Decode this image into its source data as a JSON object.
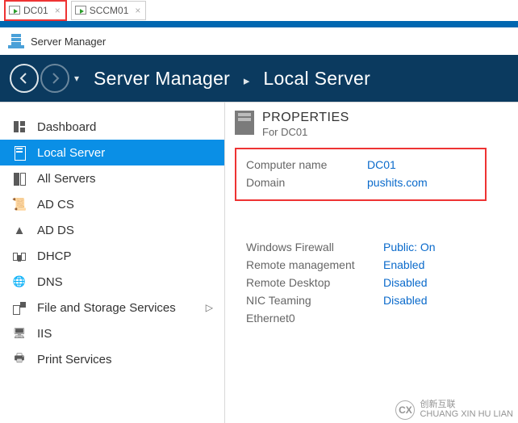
{
  "vm_tabs": [
    {
      "label": "DC01",
      "active": true
    },
    {
      "label": "SCCM01",
      "active": false
    }
  ],
  "window_title": "Server Manager",
  "breadcrumb": {
    "root": "Server Manager",
    "page": "Local Server",
    "sep": "▸"
  },
  "sidebar": {
    "items": [
      {
        "label": "Dashboard"
      },
      {
        "label": "Local Server"
      },
      {
        "label": "All Servers"
      },
      {
        "label": "AD CS"
      },
      {
        "label": "AD DS"
      },
      {
        "label": "DHCP"
      },
      {
        "label": "DNS"
      },
      {
        "label": "File and Storage Services"
      },
      {
        "label": "IIS"
      },
      {
        "label": "Print Services"
      }
    ]
  },
  "properties": {
    "heading": "PROPERTIES",
    "for_prefix": "For ",
    "for_target": "DC01",
    "rows_top": [
      {
        "k": "Computer name",
        "v": "DC01"
      },
      {
        "k": "Domain",
        "v": "pushits.com"
      }
    ],
    "rows_bottom": [
      {
        "k": "Windows Firewall",
        "v": "Public: On"
      },
      {
        "k": "Remote management",
        "v": "Enabled"
      },
      {
        "k": "Remote Desktop",
        "v": "Disabled"
      },
      {
        "k": "NIC Teaming",
        "v": "Disabled"
      },
      {
        "k": "Ethernet0",
        "v": ""
      }
    ]
  },
  "watermark": {
    "logo": "CX",
    "line1": "创新互联",
    "line2": "CHUANG XIN HU LIAN"
  }
}
